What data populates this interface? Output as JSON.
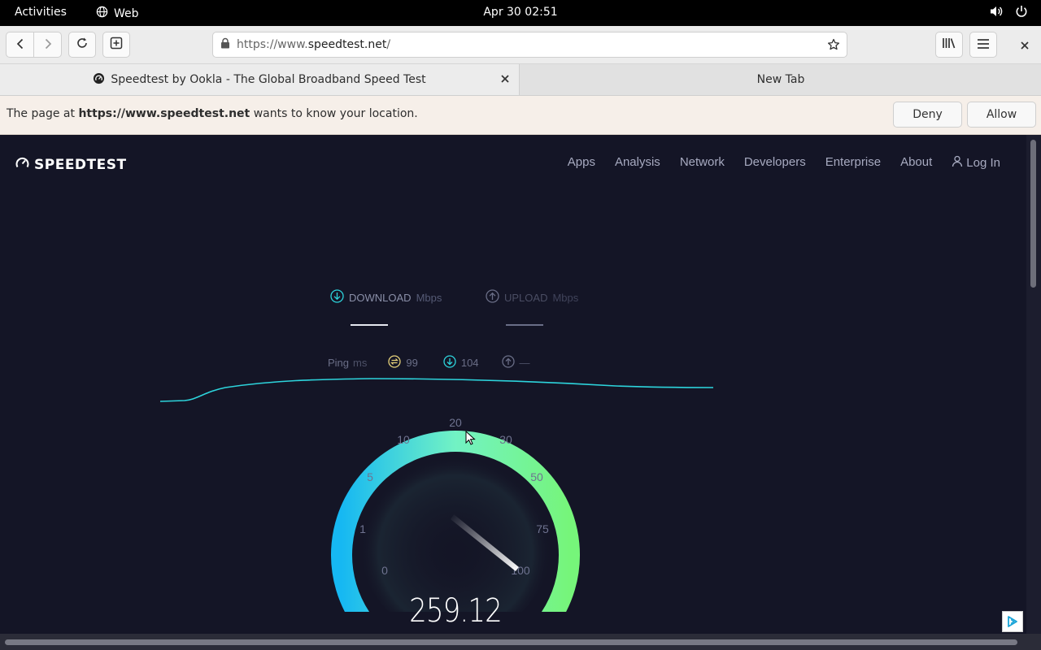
{
  "topbar": {
    "activities": "Activities",
    "app_name": "Web",
    "clock": "Apr 30  02:51",
    "icons": [
      "globe-icon",
      "volume-icon",
      "power-icon"
    ]
  },
  "browser": {
    "url_scheme": "https://www.",
    "url_host": "speedtest.net",
    "url_path": "/",
    "icons": [
      "back-icon",
      "forward-icon",
      "reload-icon",
      "new-tab-icon",
      "lock-icon",
      "bookmark-star-icon",
      "library-icon",
      "menu-icon",
      "close-icon"
    ]
  },
  "tabs": [
    {
      "title": "Speedtest by Ookla - The Global Broadband Speed Test",
      "active": true
    },
    {
      "title": "New Tab",
      "active": false
    }
  ],
  "permission": {
    "prefix": "The page at ",
    "site": "https://www.speedtest.net",
    "suffix": " wants to know your location.",
    "deny": "Deny",
    "allow": "Allow"
  },
  "page": {
    "logo": "SPEEDTEST",
    "nav": [
      "Apps",
      "Analysis",
      "Network",
      "Developers",
      "Enterprise",
      "About"
    ],
    "login": "Log In",
    "download_label": "DOWNLOAD",
    "upload_label": "UPLOAD",
    "unit": "Mbps",
    "ping_label": "Ping",
    "ping_unit": "ms",
    "ping_idle": "99",
    "ping_down": "104",
    "ping_up": "—",
    "gauge_ticks": [
      "0",
      "1",
      "5",
      "10",
      "20",
      "30",
      "50",
      "75",
      "100"
    ],
    "speed": "259.12",
    "colors": {
      "background": "#141526",
      "accent_cyan": "#16c7e8",
      "accent_green": "#6ff58a",
      "ping_yellow": "#e7d27a"
    }
  }
}
